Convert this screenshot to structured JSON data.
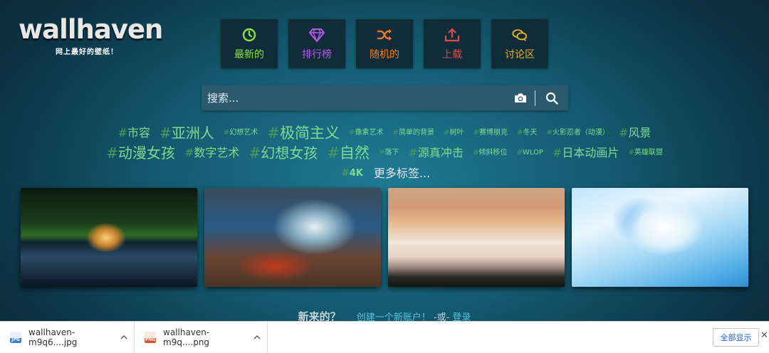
{
  "logo": {
    "name": "wallhaven",
    "tagline": "网上最好的壁纸！"
  },
  "nav": [
    {
      "label": "最新的",
      "icon": "clock-icon",
      "color": "#8fe040"
    },
    {
      "label": "排行榜",
      "icon": "diamond-icon",
      "color": "#b55be8"
    },
    {
      "label": "随机的",
      "icon": "shuffle-icon",
      "color": "#ee7d2a"
    },
    {
      "label": "上载",
      "icon": "upload-icon",
      "color": "#e04a4a"
    },
    {
      "label": "讨论区",
      "icon": "chat-icon",
      "color": "#e8b32a"
    }
  ],
  "search": {
    "placeholder": "搜索...",
    "camera_icon": "camera-icon",
    "search_icon": "magnifier-icon"
  },
  "tags": {
    "hash": "#",
    "row1": [
      "市容",
      "亚洲人",
      "幻想艺术",
      "极简主义",
      "像素艺术",
      "简单的背景",
      "树叶",
      "赛博朋克",
      "冬天",
      "火影忍者（动漫）",
      "风景"
    ],
    "row2": [
      "动漫女孩",
      "数字艺术",
      "幻想女孩",
      "自然",
      "落下",
      "源真冲击",
      "倾斜移位",
      "WLOP",
      "日本动画片",
      "英雄联盟"
    ],
    "row3": [
      "4K"
    ],
    "more": "更多标签..."
  },
  "thumbnails": [
    {
      "alt": "wallpaper-1"
    },
    {
      "alt": "wallpaper-2"
    },
    {
      "alt": "wallpaper-3"
    },
    {
      "alt": "wallpaper-4"
    }
  ],
  "newbar": {
    "title": "新来的？",
    "create": "创建一个新账户！",
    "or": "-或-",
    "login": "登录"
  },
  "downloads": {
    "items": [
      {
        "name": "wallhaven-m9q6....jpg",
        "type": "JPG"
      },
      {
        "name": "wallhaven-m9q....png",
        "type": "PNG"
      }
    ],
    "show_all": "全部显示",
    "close": "✕"
  },
  "colors": {
    "tag": "#7fdc8f",
    "link": "#57c6d8",
    "bg": "#145a70"
  }
}
